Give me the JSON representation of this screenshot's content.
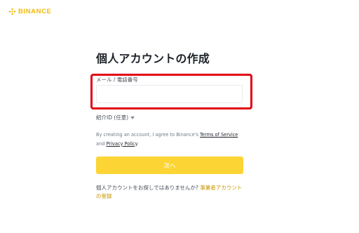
{
  "brand": {
    "name": "BINANCE",
    "color": "#f0b90b",
    "icon": "binance-logo-icon"
  },
  "form": {
    "title": "個人アカウントの作成",
    "field_label": "メール / 電話番号",
    "field_value": "",
    "referral_label": "紹介ID (任意)",
    "referral_icon": "chevron-down-icon",
    "terms_prefix": "By creating an account, I agree to Binance's ",
    "terms_link": "Terms of Service",
    "terms_middle": " and ",
    "privacy_link": "Privacy Policy",
    "terms_suffix": ".",
    "next_label": "次へ",
    "footer_prefix": "個人アカウントをお探しではありませんか? ",
    "footer_link": "事業者アカウントの登録"
  },
  "colors": {
    "accent": "#fcd535",
    "highlight": "#e30614",
    "link": "#c99400"
  }
}
